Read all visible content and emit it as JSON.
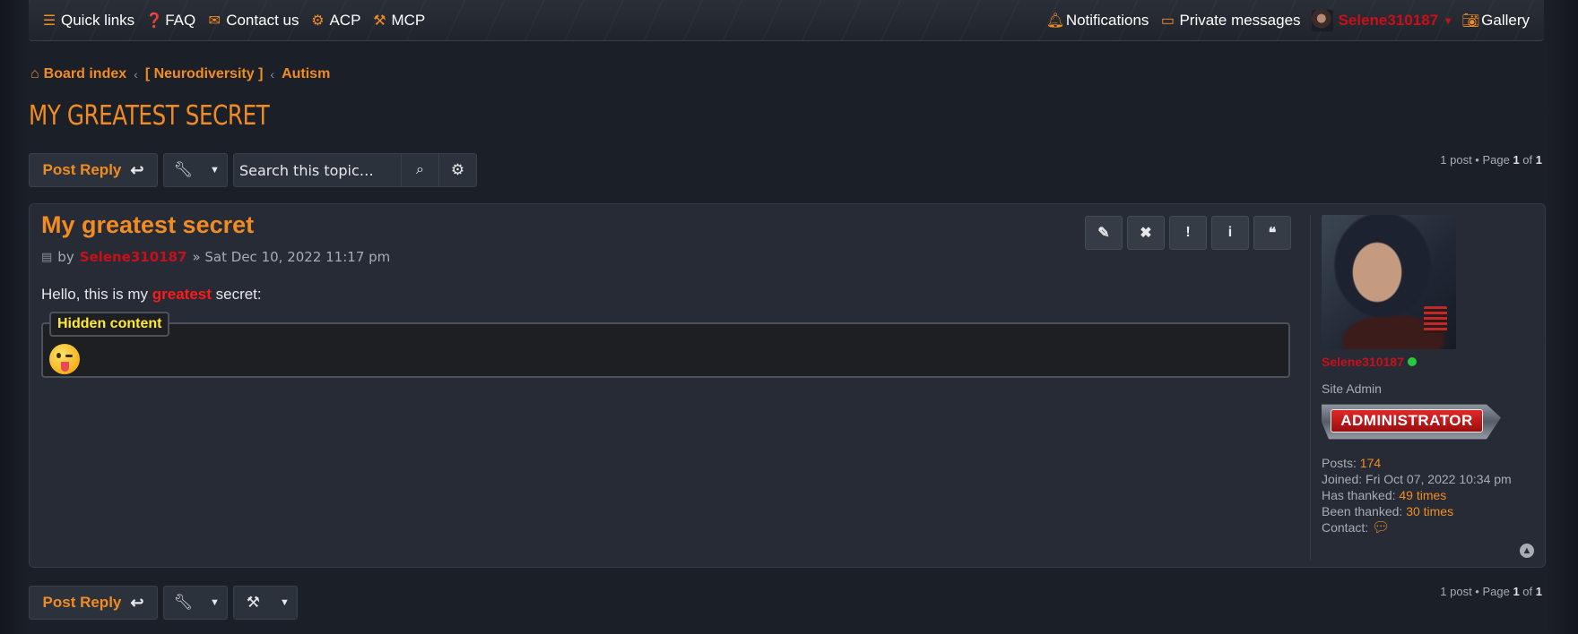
{
  "navbar": {
    "left": [
      {
        "icon": "bars-icon",
        "label": "Quick links"
      },
      {
        "icon": "question-icon",
        "label": "FAQ"
      },
      {
        "icon": "envelope-icon",
        "label": "Contact us"
      },
      {
        "icon": "cogs-icon",
        "label": "ACP"
      },
      {
        "icon": "gavel-icon",
        "label": "MCP"
      }
    ],
    "notifications": "Notifications",
    "private_messages": "Private messages",
    "username": "Selene310187",
    "gallery": "Gallery"
  },
  "breadcrumbs": {
    "home": "Board index",
    "forum": "[ Neurodiversity ]",
    "subforum": "Autism"
  },
  "topic_title": "MY GREATEST SECRET",
  "actions": {
    "post_reply": "Post Reply",
    "search_placeholder": "Search this topic…"
  },
  "pagination": {
    "prefix": "1 post • Page ",
    "current": "1",
    "of": " of ",
    "total": "1"
  },
  "post": {
    "title": "My greatest secret",
    "by": "by",
    "author": "Selene310187",
    "date": "» Sat Dec 10, 2022 11:17 pm",
    "content_before": "Hello, this is my ",
    "content_highlight": "greatest",
    "content_after": " secret:",
    "hidden_label": "Hidden content",
    "buttons": [
      "edit-icon",
      "delete-icon",
      "report-icon",
      "info-icon",
      "quote-icon"
    ]
  },
  "profile": {
    "username": "Selene310187",
    "rank": "Site Admin",
    "badge": "ADMINISTRATOR",
    "posts_label": "Posts:",
    "posts": "174",
    "joined_label": "Joined:",
    "joined": "Fri Oct 07, 2022 10:34 pm",
    "thanked_label": "Has thanked:",
    "thanked": "49 times",
    "been_thanked_label": "Been thanked:",
    "been_thanked": "30 times",
    "contact_label": "Contact:"
  },
  "colors": {
    "accent": "#f28c22",
    "author": "#c8101a",
    "highlight": "#ff1a1a",
    "hidden_label": "#ffe93a",
    "online": "#28c840"
  }
}
